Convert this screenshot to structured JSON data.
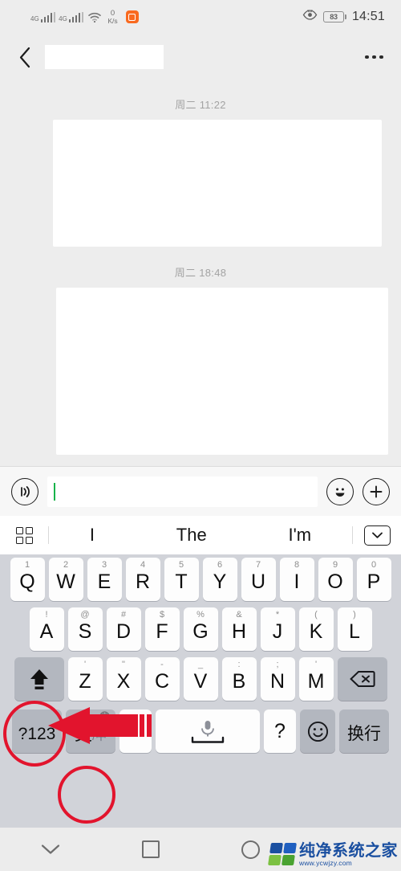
{
  "status_bar": {
    "signal_1_label": "4G",
    "signal_2_label": "4G",
    "network_speed_value": "0",
    "network_speed_unit": "K/s",
    "battery_percent": "83",
    "time": "14:51",
    "icons": [
      "signal-4g-icon",
      "signal-4g-icon",
      "wifi-icon",
      "network-speed-icon",
      "app-icon",
      "eye-care-icon",
      "battery-icon"
    ]
  },
  "header": {
    "back_icon": "chevron-left-icon",
    "title": "",
    "more_icon": "more-options-icon"
  },
  "chat": {
    "messages": [
      {
        "timestamp": "周二 11:22",
        "body": ""
      },
      {
        "timestamp": "周二 18:48",
        "body": ""
      }
    ]
  },
  "input_bar": {
    "voice_icon": "voice-input-icon",
    "text_value": "",
    "placeholder": "",
    "emoji_icon": "emoji-icon",
    "plus_icon": "plus-icon"
  },
  "keyboard": {
    "suggestions": {
      "grid_icon": "keyboard-grid-icon",
      "words": [
        "I",
        "The",
        "I'm"
      ],
      "collapse_icon": "chevron-down-icon"
    },
    "row1": [
      {
        "key": "Q",
        "hint": "1"
      },
      {
        "key": "W",
        "hint": "2"
      },
      {
        "key": "E",
        "hint": "3"
      },
      {
        "key": "R",
        "hint": "4"
      },
      {
        "key": "T",
        "hint": "5"
      },
      {
        "key": "Y",
        "hint": "6"
      },
      {
        "key": "U",
        "hint": "7"
      },
      {
        "key": "I",
        "hint": "8"
      },
      {
        "key": "O",
        "hint": "9"
      },
      {
        "key": "P",
        "hint": "0"
      }
    ],
    "row2": [
      {
        "key": "A",
        "hint": "!"
      },
      {
        "key": "S",
        "hint": "@"
      },
      {
        "key": "D",
        "hint": "#"
      },
      {
        "key": "F",
        "hint": "$"
      },
      {
        "key": "G",
        "hint": "%"
      },
      {
        "key": "H",
        "hint": "&"
      },
      {
        "key": "J",
        "hint": "*"
      },
      {
        "key": "K",
        "hint": "("
      },
      {
        "key": "L",
        "hint": ")"
      }
    ],
    "row3": {
      "shift_label": "shift-icon",
      "keys": [
        {
          "key": "Z",
          "hint": "'"
        },
        {
          "key": "X",
          "hint": "\""
        },
        {
          "key": "C",
          "hint": "-"
        },
        {
          "key": "V",
          "hint": "_"
        },
        {
          "key": "B",
          "hint": ":"
        },
        {
          "key": "N",
          "hint": ";"
        },
        {
          "key": "M",
          "hint": "'"
        }
      ],
      "delete_label": "backspace-icon"
    },
    "row4": {
      "symbols_label": "?123",
      "language_en": "英",
      "language_cn": "/中",
      "period_label": "·",
      "space_label": "space-mic-icon",
      "question_label": "?",
      "emoji_label": "emoji-icon",
      "enter_label": "换行"
    }
  },
  "nav_bar": {
    "collapse_icon": "chevron-down-icon",
    "recents_icon": "square-icon",
    "home_icon": "circle-icon"
  },
  "watermark": {
    "brand": "纯净系统之家",
    "url": "www.ycwjzy.com"
  },
  "annotations": {
    "color": "#e2142d",
    "shift_highlight": "red-circle-shift-key",
    "language_highlight": "red-circle-language-key",
    "arrow": "red-arrow-pointing-to-shift"
  }
}
